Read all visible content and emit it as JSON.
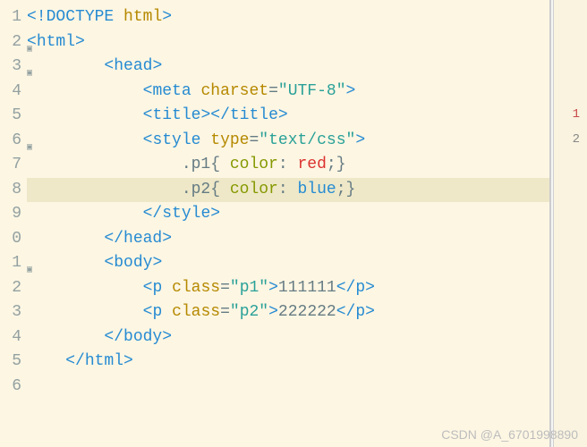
{
  "gutter": {
    "lines": [
      "1",
      "2",
      "3",
      "4",
      "5",
      "6",
      "7",
      "8",
      "9",
      "0",
      "1",
      "2",
      "3",
      "4",
      "5",
      "6"
    ],
    "fold_markers": [
      1,
      2,
      5,
      10
    ]
  },
  "highlighted_line_index": 7,
  "code": {
    "l1": {
      "open": "<!",
      "tag": "DOCTYPE",
      "sp": " ",
      "attr": "html",
      "close": ">"
    },
    "l2": {
      "open": "<",
      "tag": "html",
      "close": ">"
    },
    "l3": {
      "indent": "        ",
      "open": "<",
      "tag": "head",
      "close": ">"
    },
    "l4": {
      "indent": "            ",
      "open": "<",
      "tag": "meta",
      "sp": " ",
      "attr": "charset",
      "eq": "=",
      "str": "\"UTF-8\"",
      "close": ">"
    },
    "l5": {
      "indent": "            ",
      "open": "<",
      "tag": "title",
      "close": ">",
      "open2": "</",
      "tag2": "title",
      "close2": ">"
    },
    "l6": {
      "indent": "            ",
      "open": "<",
      "tag": "style",
      "sp": " ",
      "attr": "type",
      "eq": "=",
      "str": "\"text/css\"",
      "close": ">"
    },
    "l7": {
      "indent": "                ",
      "sel": ".p1",
      "brace": "{ ",
      "prop": "color",
      "colon": ": ",
      "val": "red",
      "semi": ";",
      "cbrace": "}"
    },
    "l8": {
      "indent": "                ",
      "sel": ".p2",
      "brace": "{ ",
      "prop": "color",
      "colon": ": ",
      "val": "blue",
      "semi": ";",
      "cbrace": "}"
    },
    "l9": {
      "indent": "            ",
      "open": "</",
      "tag": "style",
      "close": ">"
    },
    "l10": {
      "indent": "        ",
      "open": "</",
      "tag": "head",
      "close": ">"
    },
    "l11": {
      "indent": "        ",
      "open": "<",
      "tag": "body",
      "close": ">"
    },
    "l12": {
      "indent": "            ",
      "open": "<",
      "tag": "p",
      "sp": " ",
      "attr": "class",
      "eq": "=",
      "str": "\"p1\"",
      "close": ">",
      "txt": "111111",
      "open2": "</",
      "tag2": "p",
      "close2": ">"
    },
    "l13": {
      "indent": "            ",
      "open": "<",
      "tag": "p",
      "sp": " ",
      "attr": "class",
      "eq": "=",
      "str": "\"p2\"",
      "close": ">",
      "txt": "222222",
      "open2": "</",
      "tag2": "p",
      "close2": ">"
    },
    "l14": {
      "indent": "        ",
      "open": "</",
      "tag": "body",
      "close": ">"
    },
    "l15": {
      "indent": "    ",
      "open": "</",
      "tag": "html",
      "close": ">"
    },
    "l16": {
      "indent": ""
    }
  },
  "right_panel": {
    "mark1": "1",
    "mark2": "2"
  },
  "watermark": "CSDN @A_6701998890"
}
